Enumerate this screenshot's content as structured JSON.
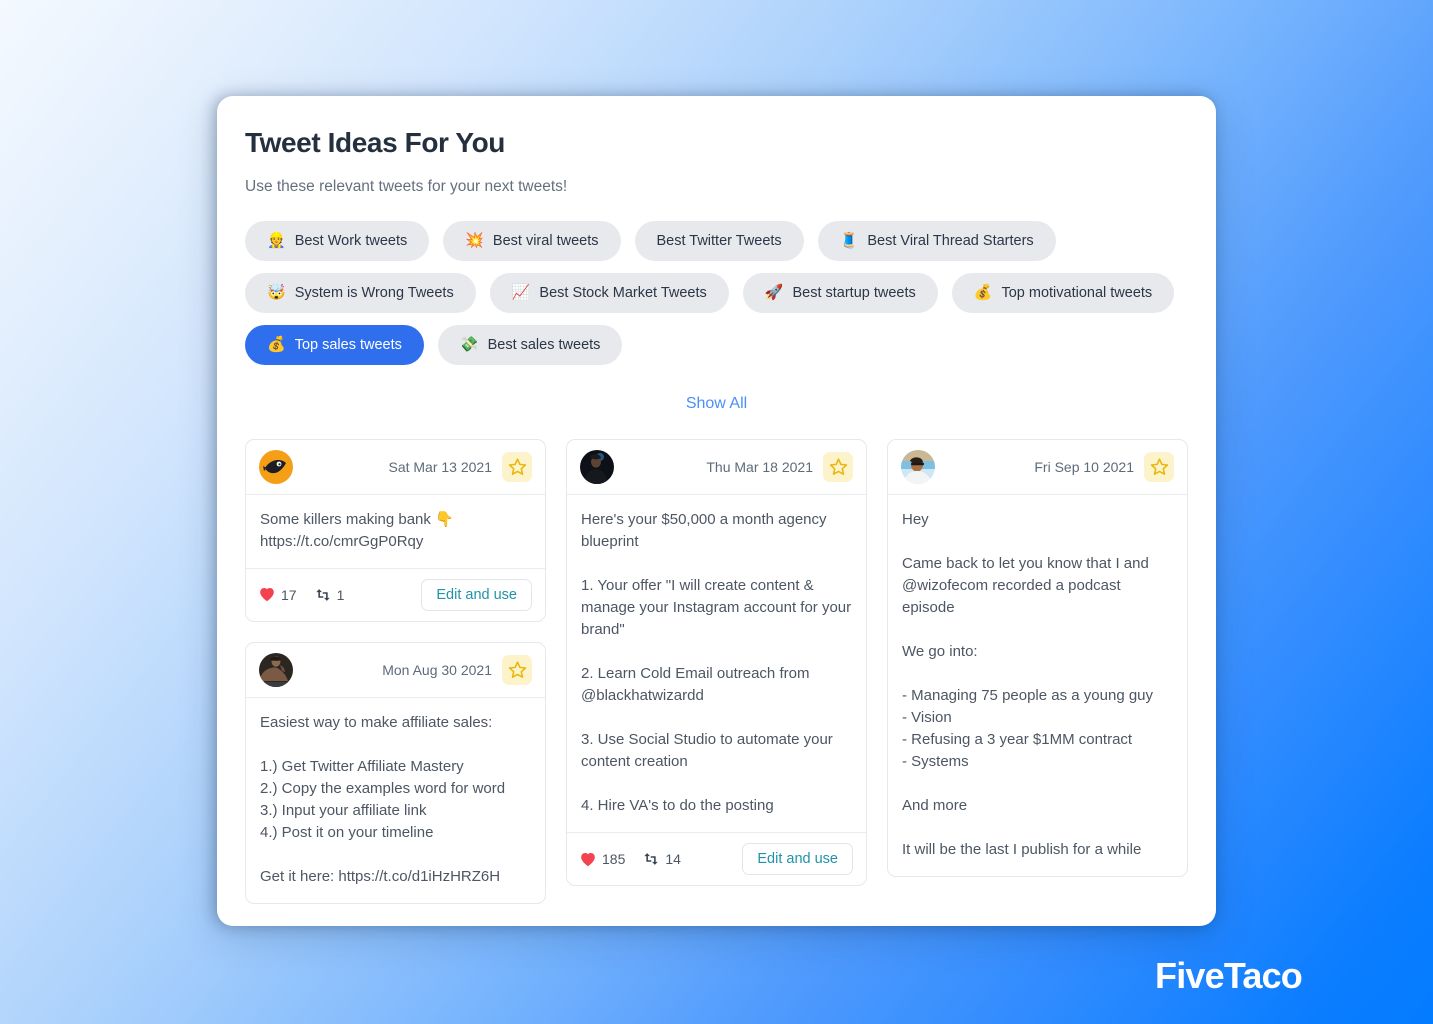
{
  "app": {
    "brand": "FiveTaco",
    "title": "Tweet Ideas For You",
    "subtitle": "Use these relevant tweets for your next tweets!",
    "show_all_label": "Show All",
    "accent_color": "#2f6fee",
    "link_color": "#4a90f7",
    "edit_button_color": "#2193a8",
    "star_color": "#e8b80e"
  },
  "tags": [
    {
      "emoji": "👷",
      "icon": "construction-worker-emoji",
      "label": "Best Work tweets",
      "selected": false
    },
    {
      "emoji": "💥",
      "icon": "collision-emoji",
      "label": "Best viral tweets",
      "selected": false
    },
    {
      "emoji": "",
      "icon": "",
      "label": "Best Twitter Tweets",
      "selected": false
    },
    {
      "emoji": "🧵",
      "icon": "thread-emoji",
      "label": "Best Viral Thread Starters",
      "selected": false
    },
    {
      "emoji": "🤯",
      "icon": "exploding-head-emoji",
      "label": "System is Wrong Tweets",
      "selected": false
    },
    {
      "emoji": "📈",
      "icon": "chart-increasing-emoji",
      "label": "Best Stock Market Tweets",
      "selected": false
    },
    {
      "emoji": "🚀",
      "icon": "rocket-emoji",
      "label": "Best startup tweets",
      "selected": false
    },
    {
      "emoji": "💰",
      "icon": "money-bag-emoji",
      "label": "Top motivational tweets",
      "selected": false
    },
    {
      "emoji": "💰",
      "icon": "money-bag-emoji",
      "label": "Top sales tweets",
      "selected": true
    },
    {
      "emoji": "💸",
      "icon": "money-with-wings-emoji",
      "label": "Best sales tweets",
      "selected": false
    }
  ],
  "columns": [
    {
      "cards": [
        {
          "date": "Sat Mar 13 2021",
          "avatar": "bat-avatar",
          "text": "Some killers making bank 👇\nhttps://t.co/cmrGgP0Rqy",
          "likes": "17",
          "retweets": "1",
          "edit_label": "Edit and use",
          "has_footer": true
        },
        {
          "date": "Mon Aug 30 2021",
          "avatar": "person-avatar",
          "text": "Easiest way to make affiliate sales:\n\n1.) Get Twitter Affiliate Mastery\n2.) Copy the examples word for word\n3.) Input your affiliate link\n4.) Post it on your timeline\n\nGet it here: https://t.co/d1iHzHRZ6H",
          "likes": "",
          "retweets": "",
          "edit_label": "Edit and use",
          "has_footer": false
        }
      ]
    },
    {
      "cards": [
        {
          "date": "Thu Mar 18 2021",
          "avatar": "night-avatar",
          "text": "Here's your $50,000 a month agency blueprint\n\n1. Your offer \"I will create content & manage your Instagram account for your brand\"\n\n2. Learn Cold Email outreach from @blackhatwizardd\n\n3. Use Social Studio to automate your content creation\n\n4. Hire VA's to do the posting",
          "likes": "185",
          "retweets": "14",
          "edit_label": "Edit and use",
          "has_footer": true
        }
      ]
    },
    {
      "cards": [
        {
          "date": "Fri Sep 10 2021",
          "avatar": "beach-avatar",
          "text": "Hey\n\nCame back to let you know that I and @wizofecom recorded a podcast episode\n\nWe go into:\n\n- Managing 75 people as a young guy\n- Vision\n- Refusing a 3 year $1MM contract\n- Systems\n\nAnd more\n\nIt will be the last I publish for a while",
          "likes": "",
          "retweets": "",
          "edit_label": "Edit and use",
          "has_footer": false
        }
      ]
    }
  ]
}
